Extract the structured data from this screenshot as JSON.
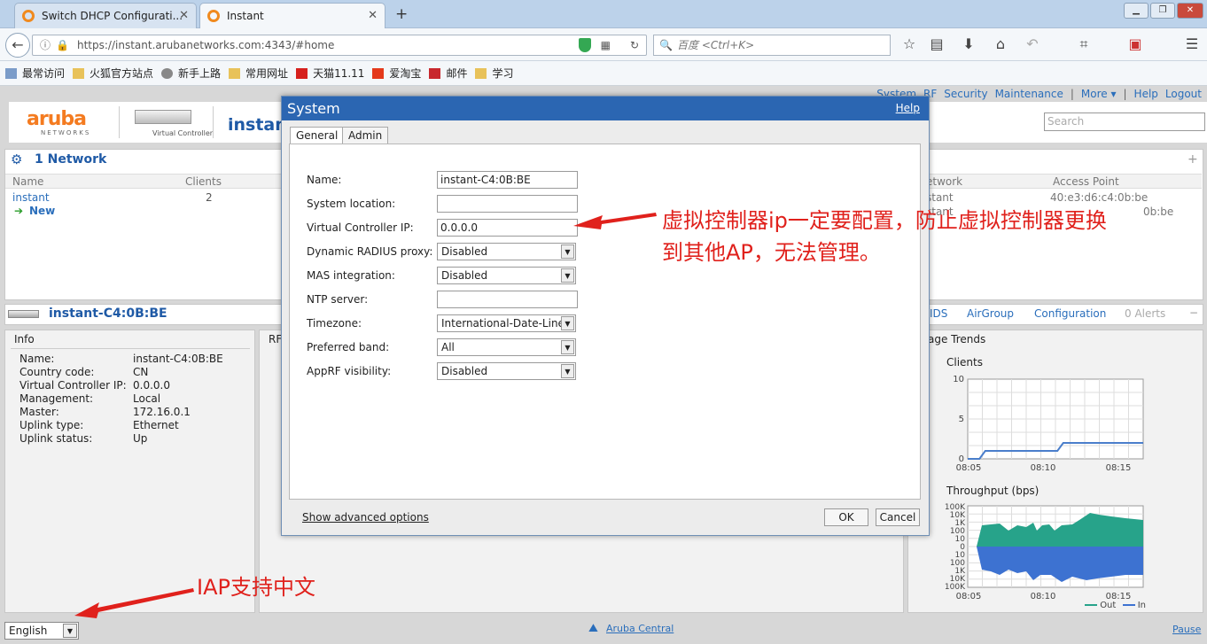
{
  "browser": {
    "tabs": [
      {
        "label": "Switch DHCP Configurati..."
      },
      {
        "label": "Instant"
      }
    ],
    "url": "https://instant.arubanetworks.com:4343/#home",
    "search_placeholder": "百度 <Ctrl+K>",
    "bookmarks": [
      "最常访问",
      "火狐官方站点",
      "新手上路",
      "常用网址",
      "天猫11.11",
      "爱淘宝",
      "邮件",
      "学习"
    ]
  },
  "app": {
    "top_links": [
      "System",
      "RF",
      "Security",
      "Maintenance",
      "|",
      "More ▾",
      "|",
      "Help",
      "Logout"
    ],
    "search_placeholder": "Search",
    "logo": "aruba",
    "logo_sub": "NETWORKS",
    "controller_caption": "Virtual Controller",
    "header_title": "instant",
    "networks": {
      "title": "1 Network",
      "col_name": "Name",
      "col_clients": "Clients",
      "row_name": "instant",
      "row_clients": "2",
      "new_label": "New"
    },
    "access_points": {
      "col_network": "etwork",
      "col_ap": "Access Point",
      "rows": [
        {
          "network": "stant",
          "ap": "40:e3:d6:c4:0b:be"
        },
        {
          "network": "stant",
          "ap": "0b:be"
        }
      ]
    },
    "device": {
      "title": "instant-C4:0B:BE",
      "tabs": [
        "IDS",
        "AirGroup",
        "Configuration",
        "0 Alerts"
      ]
    },
    "info": {
      "title": "Info",
      "rf_title": "RF",
      "rows": [
        {
          "k": "Name:",
          "v": "instant-C4:0B:BE"
        },
        {
          "k": "Country code:",
          "v": "CN"
        },
        {
          "k": "Virtual Controller IP:",
          "v": "0.0.0.0"
        },
        {
          "k": "Management:",
          "v": "Local"
        },
        {
          "k": "Master:",
          "v": "172.16.0.1"
        },
        {
          "k": "Uplink type:",
          "v": "Ethernet"
        },
        {
          "k": "Uplink status:",
          "v": "Up"
        }
      ]
    },
    "usage_title": "age Trends",
    "clients_chart": {
      "title": "Clients",
      "y_ticks": [
        "10",
        "5",
        "0"
      ],
      "x_ticks": [
        "08:05",
        "08:10",
        "08:15"
      ],
      "series": [
        0,
        1,
        1,
        1,
        1,
        2,
        2,
        2,
        2,
        2
      ]
    },
    "throughput_chart": {
      "title": "Throughput (bps)",
      "y_ticks": [
        "100K",
        "10K",
        "1K",
        "100",
        "10",
        "0",
        "10",
        "100",
        "1K",
        "10K",
        "100K"
      ],
      "x_ticks": [
        "08:05",
        "08:10",
        "08:15"
      ],
      "legend": [
        "Out",
        "In"
      ]
    },
    "language": "English",
    "footer_link": "Aruba Central",
    "pause": "Pause"
  },
  "dialog": {
    "title": "System",
    "help": "Help",
    "tabs": [
      "General",
      "Admin"
    ],
    "fields": {
      "name_label": "Name:",
      "name_value": "instant-C4:0B:BE",
      "location_label": "System location:",
      "location_value": "",
      "vcip_label": "Virtual Controller IP:",
      "vcip_value": "0.0.0.0",
      "radius_label": "Dynamic RADIUS proxy:",
      "radius_value": "Disabled",
      "mas_label": "MAS integration:",
      "mas_value": "Disabled",
      "ntp_label": "NTP server:",
      "ntp_value": "",
      "tz_label": "Timezone:",
      "tz_value": "International-Date-Line",
      "band_label": "Preferred band:",
      "band_value": "All",
      "apprf_label": "AppRF visibility:",
      "apprf_value": "Disabled"
    },
    "advanced": "Show advanced options",
    "ok": "OK",
    "cancel": "Cancel"
  },
  "annotations": {
    "vc_note_line1": "虚拟控制器ip一定要配置，防止虚拟控制器更换",
    "vc_note_line2": "到其他AP，无法管理。",
    "lang_note": "IAP支持中文",
    "color": "#e0211c"
  }
}
